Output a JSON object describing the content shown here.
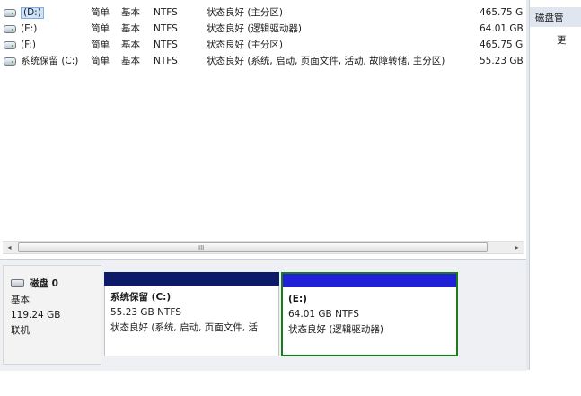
{
  "volumes": [
    {
      "name": "(D:)",
      "layout": "简单",
      "type": "基本",
      "fs": "NTFS",
      "status": "状态良好 (主分区)",
      "capacity": "465.75 G",
      "selected": true
    },
    {
      "name": "(E:)",
      "layout": "简单",
      "type": "基本",
      "fs": "NTFS",
      "status": "状态良好 (逻辑驱动器)",
      "capacity": "64.01 GB",
      "selected": false
    },
    {
      "name": "(F:)",
      "layout": "简单",
      "type": "基本",
      "fs": "NTFS",
      "status": "状态良好 (主分区)",
      "capacity": "465.75 G",
      "selected": false
    },
    {
      "name": "系统保留 (C:)",
      "layout": "简单",
      "type": "基本",
      "fs": "NTFS",
      "status": "状态良好 (系统, 启动, 页面文件, 活动, 故障转储, 主分区)",
      "capacity": "55.23 GB",
      "selected": false
    }
  ],
  "scrollbar": {
    "left_arrow": "◂",
    "right_arrow": "▸",
    "grip": "III"
  },
  "disk": {
    "title": "磁盘 0",
    "type": "基本",
    "size": "119.24 GB",
    "state": "联机",
    "partitions": [
      {
        "name": "系统保留  (C:)",
        "size": "55.23 GB NTFS",
        "status": "状态良好 (系统, 启动, 页面文件, 活"
      },
      {
        "name": "(E:)",
        "size": "64.01 GB NTFS",
        "status": "状态良好 (逻辑驱动器)"
      }
    ]
  },
  "action_pane": {
    "header": "磁盘管",
    "more": "更"
  },
  "colors": {
    "system_partition_bar": "#0d1a6a",
    "logical_partition_bar": "#1f20d8",
    "selection_border": "#1b7a1b"
  }
}
